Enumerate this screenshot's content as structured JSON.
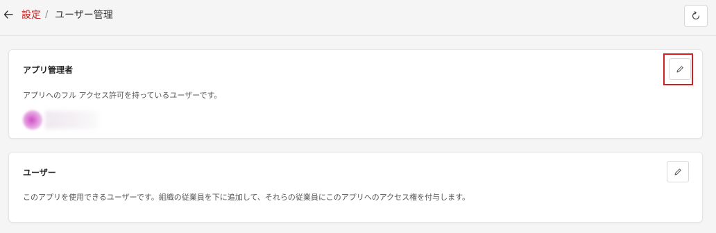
{
  "header": {
    "back_icon": "arrow-left-icon",
    "breadcrumb_parent": "設定",
    "breadcrumb_separator": "/",
    "breadcrumb_current": "ユーザー管理",
    "refresh_icon": "refresh-icon"
  },
  "sections": {
    "admins": {
      "title": "アプリ管理者",
      "description": "アプリへのフル アクセス許可を持っているユーザーです。",
      "edit_icon": "pencil-icon",
      "highlighted": true
    },
    "users": {
      "title": "ユーザー",
      "description": "このアプリを使用できるユーザーです。組織の従業員を下に追加して、それらの従業員にこのアプリへのアクセス権を付与します。",
      "edit_icon": "pencil-icon"
    }
  },
  "colors": {
    "breadcrumb_link": "#c62828",
    "highlight_border": "#d21f1f",
    "background": "#f5f5f5"
  }
}
